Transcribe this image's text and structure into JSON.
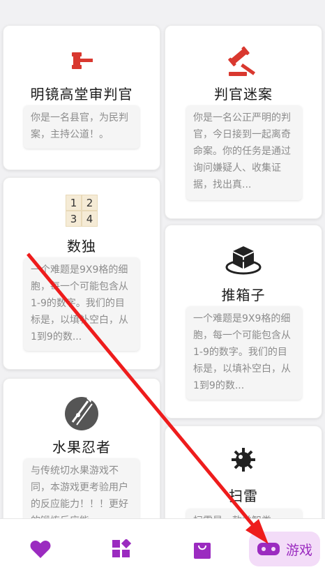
{
  "cards": [
    {
      "title": "明镜高堂审判官",
      "desc": "你是一名县官，为民判案，主持公道！。",
      "icon": "gavel-icon"
    },
    {
      "title": "判官迷案",
      "desc": "你是一名公正严明的判官，今日接到一起离奇命案。你的任务是通过询问嫌疑人、收集证据，找出真...",
      "icon": "gavel-strike-icon"
    },
    {
      "title": "数独",
      "desc": "一个难题是9X9格的细胞，每一个可能包含从1-9的数字。我们的目标是，以填补空白，从1到9的数...",
      "icon": "sudoku-icon",
      "grid": [
        "1",
        "2",
        "3",
        "4"
      ]
    },
    {
      "title": "推箱子",
      "desc": "一个难题是9X9格的细胞，每一个可能包含从1-9的数字。我们的目标是，以填补空白，从1到9的数...",
      "icon": "box-icon"
    },
    {
      "title": "水果忍者",
      "desc": "与传统切水果游戏不同，本游戏更考验用户的反应能力！！！更好的锻炼反应能...",
      "icon": "fruit-ninja-icon"
    },
    {
      "title": "扫雷",
      "desc": "扫雷是一款益智类...",
      "icon": "mine-icon"
    }
  ],
  "nav": {
    "items": [
      {
        "icon": "heart-icon"
      },
      {
        "icon": "apps-icon"
      },
      {
        "icon": "bag-icon"
      },
      {
        "icon": "gamepad-icon",
        "label": "游戏"
      }
    ]
  },
  "colors": {
    "accent": "#9b2bc0",
    "active_bg": "#f3dcf8",
    "gavel_red": "#d9382f",
    "arrow_red": "#ee1c1c"
  }
}
